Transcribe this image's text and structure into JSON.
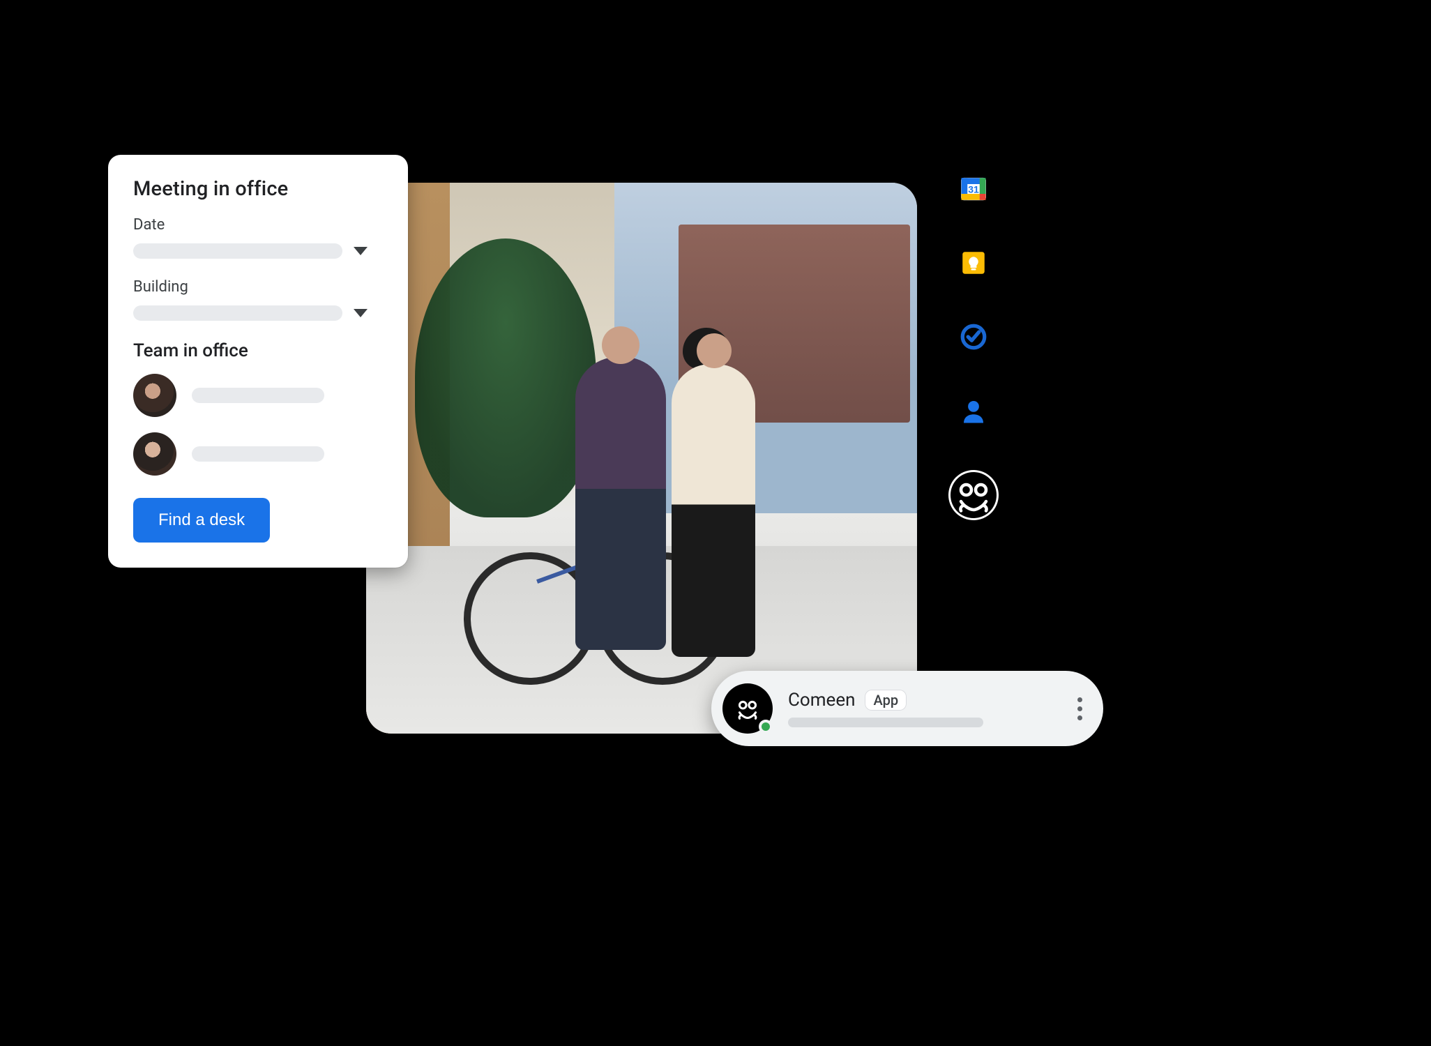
{
  "card": {
    "title": "Meeting in office",
    "date_label": "Date",
    "building_label": "Building",
    "team_title": "Team in office",
    "cta_label": "Find a desk"
  },
  "rail": {
    "apps": [
      {
        "id": "calendar",
        "name": "Google Calendar",
        "day": "31"
      },
      {
        "id": "keep",
        "name": "Google Keep"
      },
      {
        "id": "tasks",
        "name": "Google Tasks"
      },
      {
        "id": "contacts",
        "name": "Google Contacts"
      },
      {
        "id": "comeen",
        "name": "Comeen",
        "selected": true
      }
    ]
  },
  "bubble": {
    "app_name": "Comeen",
    "badge": "App",
    "presence": "online"
  },
  "colors": {
    "primary": "#1a73e8",
    "keep_yellow": "#fbbc04",
    "tasks_blue": "#1967d2",
    "person_blue": "#1a73e8",
    "presence_green": "#34a853"
  }
}
